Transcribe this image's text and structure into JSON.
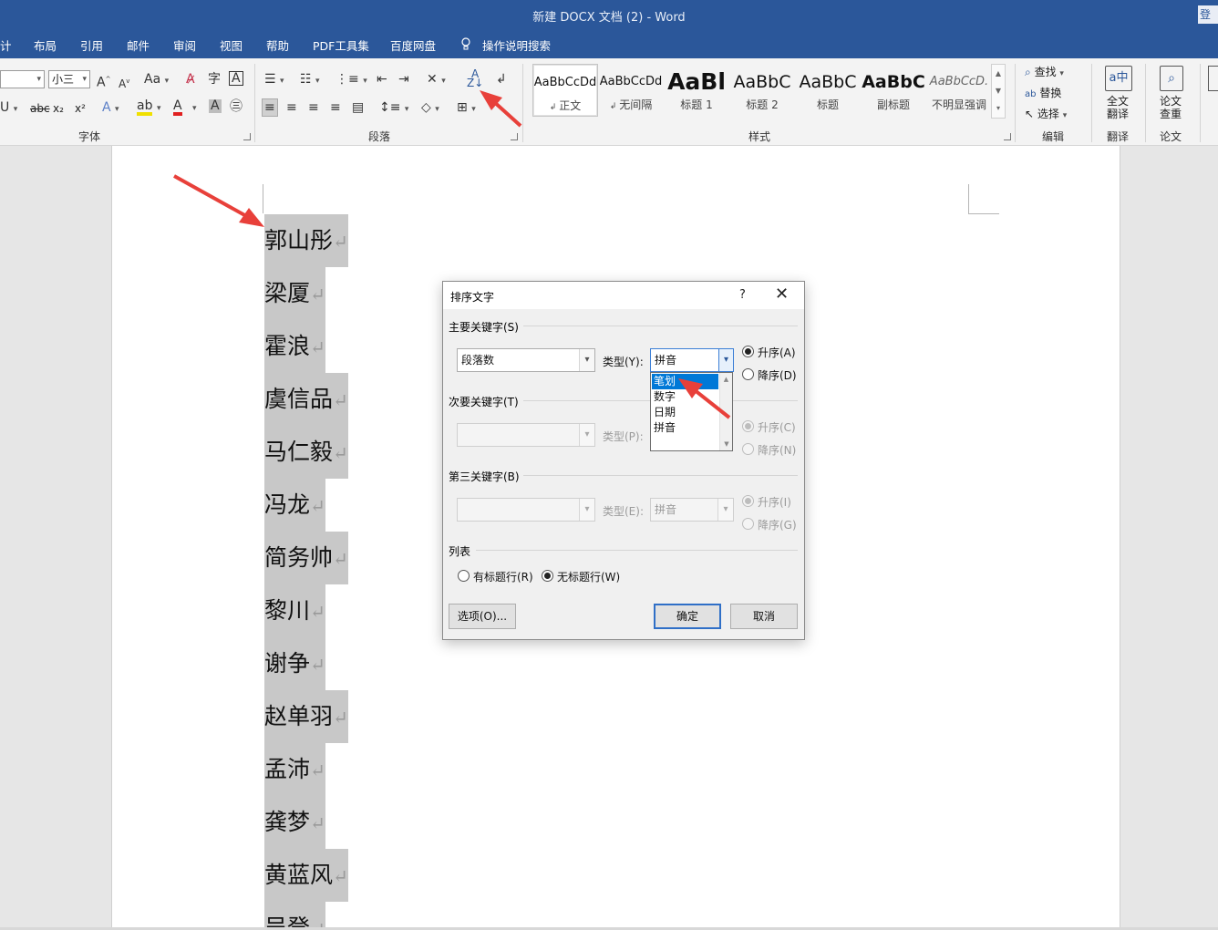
{
  "window": {
    "title": "新建 DOCX 文档 (2)  -  Word",
    "signin": "登"
  },
  "tabs": [
    "计",
    "布局",
    "引用",
    "邮件",
    "审阅",
    "视图",
    "帮助",
    "PDF工具集",
    "百度网盘",
    "操作说明搜索"
  ],
  "ribbon": {
    "font": {
      "size_value": "小三",
      "group_label": "字体"
    },
    "paragraph": {
      "group_label": "段落"
    },
    "styles": {
      "group_label": "样式",
      "items": [
        {
          "preview": "AaBbCcDd",
          "name": "正文"
        },
        {
          "preview": "AaBbCcDd",
          "name": "无间隔"
        },
        {
          "preview": "AaBl",
          "name": "标题 1"
        },
        {
          "preview": "AaBbC",
          "name": "标题 2"
        },
        {
          "preview": "AaBbC",
          "name": "标题"
        },
        {
          "preview": "AaBbC",
          "name": "副标题"
        },
        {
          "preview": "AaBbCcD.",
          "name": "不明显强调"
        }
      ]
    },
    "editing": {
      "find": "查找",
      "replace": "替换",
      "select": "选择",
      "group_label": "编辑"
    },
    "translate": {
      "button": [
        "全文",
        "翻译"
      ],
      "group_label": "翻译"
    },
    "paper": {
      "button": [
        "论文",
        "查重"
      ],
      "group_label": "论文"
    }
  },
  "document": {
    "lines": [
      "郭山彤",
      "梁厦",
      "霍浪",
      "虞信品",
      "马仁毅",
      "冯龙",
      "简务帅",
      "黎川",
      "谢争",
      "赵单羽",
      "孟沛",
      "龚梦",
      "黄蓝风",
      "吴登"
    ],
    "paragraph_mark": "↵"
  },
  "dialog": {
    "title": "排序文字",
    "help": "?",
    "close": "✕",
    "primary": {
      "section": "主要关键字(S)",
      "key_value": "段落数",
      "type_label": "类型(Y):",
      "type_value": "拼音",
      "asc": "升序(A)",
      "desc": "降序(D)"
    },
    "secondary": {
      "section": "次要关键字(T)",
      "key_value": "",
      "type_label": "类型(P):",
      "type_value": "",
      "asc": "升序(C)",
      "desc": "降序(N)"
    },
    "third": {
      "section": "第三关键字(B)",
      "key_value": "",
      "type_label": "类型(E):",
      "type_value": "拼音",
      "asc": "升序(I)",
      "desc": "降序(G)"
    },
    "list": {
      "section": "列表",
      "has_header": "有标题行(R)",
      "no_header": "无标题行(W)"
    },
    "buttons": {
      "options": "选项(O)...",
      "ok": "确定",
      "cancel": "取消"
    },
    "type_options": [
      "笔划",
      "数字",
      "日期",
      "拼音"
    ],
    "selected_option": "笔划"
  },
  "colors": {
    "title_bar": "#2b579a",
    "selection": "#0078d7",
    "annotation_arrow": "#e8403a"
  }
}
